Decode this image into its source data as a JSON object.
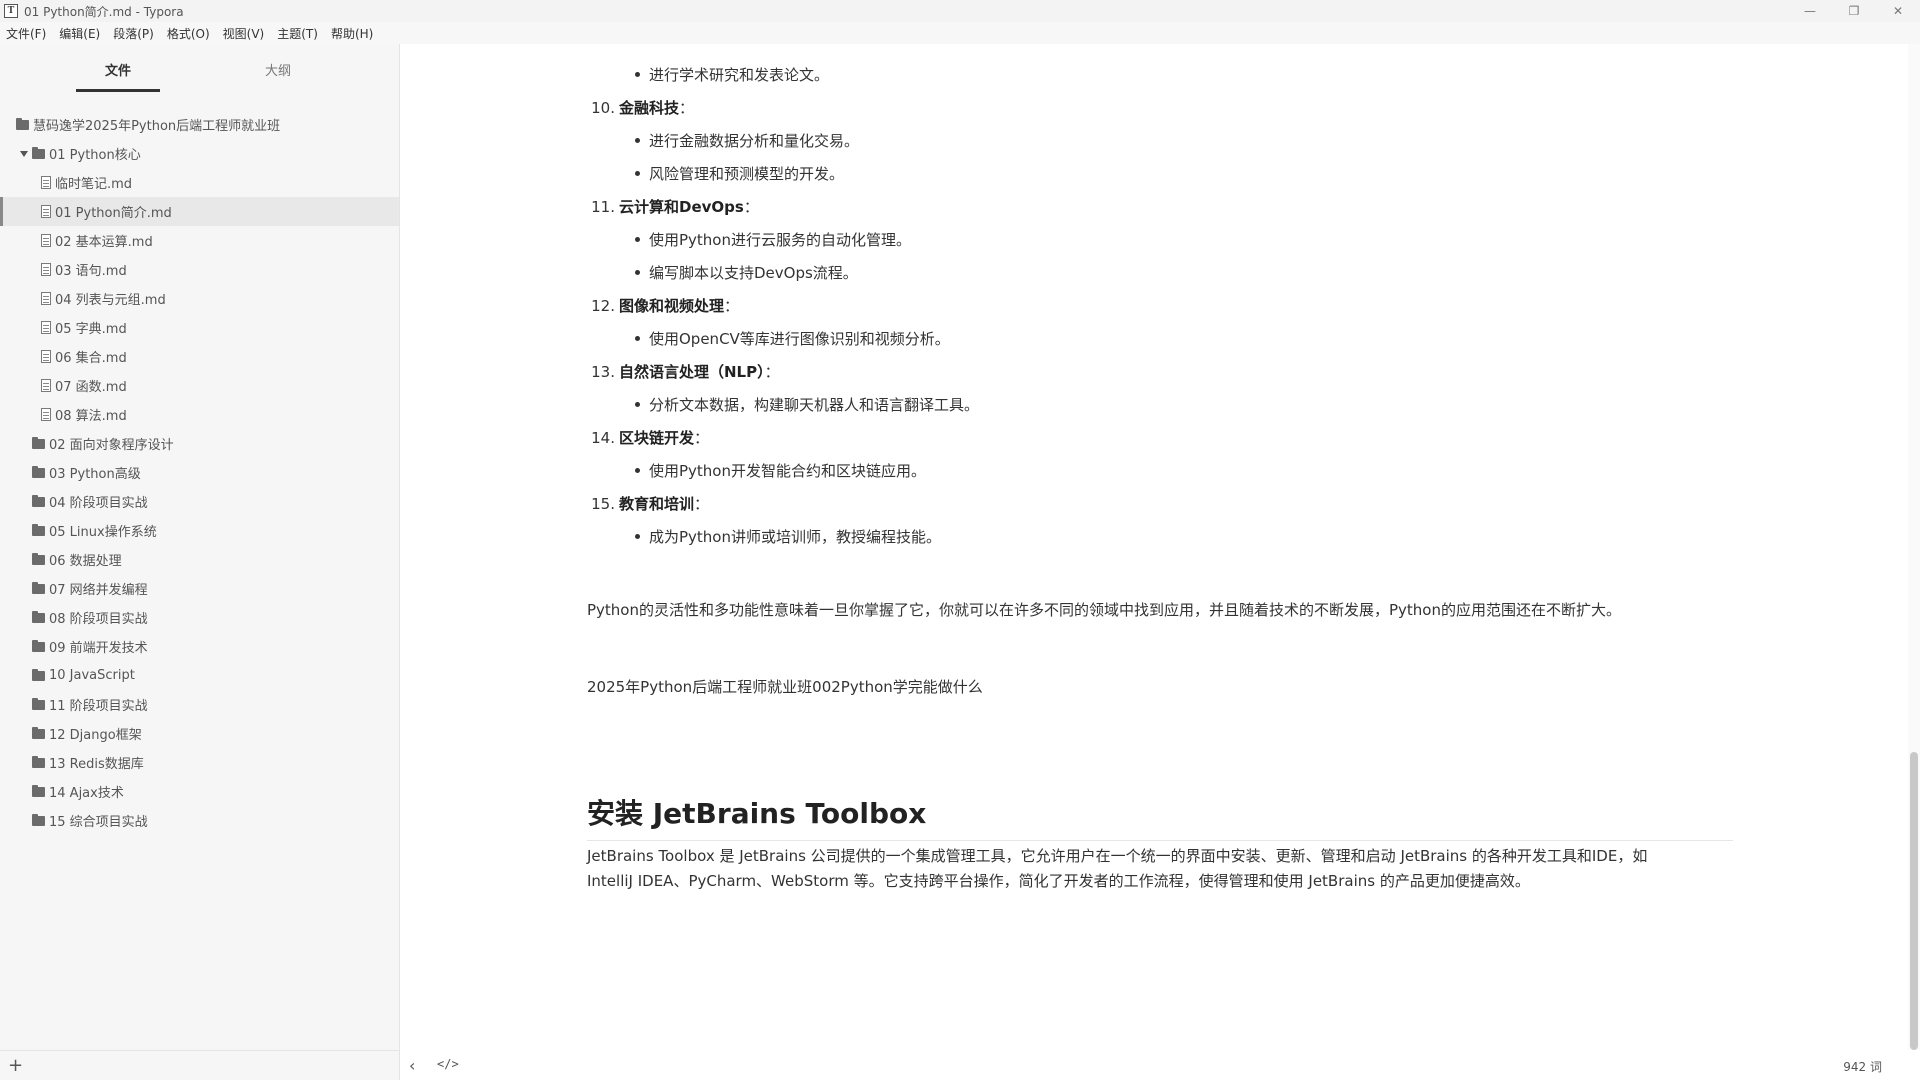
{
  "window": {
    "icon_letter": "T",
    "title": "01 Python简介.md - Typora",
    "minimize": "—",
    "maximize": "❐",
    "close": "✕"
  },
  "menu": [
    "文件(F)",
    "编辑(E)",
    "段落(P)",
    "格式(O)",
    "视图(V)",
    "主题(T)",
    "帮助(H)"
  ],
  "sidebar": {
    "tabs": [
      "文件",
      "大纲"
    ],
    "root": "慧码逸学2025年Python后端工程师就业班",
    "expanded_folder": "01 Python核心",
    "files": [
      "临时笔记.md",
      "01 Python简介.md",
      "02 基本运算.md",
      "03 语句.md",
      "04 列表与元组.md",
      "05 字典.md",
      "06 集合.md",
      "07 函数.md",
      "08 算法.md"
    ],
    "active_file_index": 1,
    "folders": [
      "02 面向对象程序设计",
      "03 Python高级",
      "04 阶段项目实战",
      "05 Linux操作系统",
      "06 数据处理",
      "07 网络并发编程",
      "08 阶段项目实战",
      "09 前端开发技术",
      "10 JavaScript",
      "11 阶段项目实战",
      "12 Django框架",
      "13 Redis数据库",
      "14 Ajax技术",
      "15 综合项目实战"
    ],
    "add_label": "+"
  },
  "editor": {
    "top_item": "进行学术研究和发表论文。",
    "sections": [
      {
        "num": "10.",
        "title": "金融科技",
        "suffix": "：",
        "items": [
          "进行金融数据分析和量化交易。",
          "风险管理和预测模型的开发。"
        ]
      },
      {
        "num": "11.",
        "title": "云计算和DevOps",
        "suffix": "：",
        "items": [
          "使用Python进行云服务的自动化管理。",
          "编写脚本以支持DevOps流程。"
        ]
      },
      {
        "num": "12.",
        "title": "图像和视频处理",
        "suffix": "：",
        "items": [
          "使用OpenCV等库进行图像识别和视频分析。"
        ]
      },
      {
        "num": "13.",
        "title": "自然语言处理（NLP）",
        "suffix": "：",
        "items": [
          "分析文本数据，构建聊天机器人和语言翻译工具。"
        ]
      },
      {
        "num": "14.",
        "title": "区块链开发",
        "suffix": "：",
        "items": [
          "使用Python开发智能合约和区块链应用。"
        ]
      },
      {
        "num": "15.",
        "title": "教育和培训",
        "suffix": "：",
        "items": [
          "成为Python讲师或培训师，教授编程技能。"
        ]
      }
    ],
    "para1": "Python的灵活性和多功能性意味着一旦你掌握了它，你就可以在许多不同的领域中找到应用，并且随着技术的不断发展，Python的应用范围还在不断扩大。",
    "para2": "2025年Python后端工程师就业班002Python学完能做什么",
    "heading": "安装 JetBrains Toolbox",
    "para3_line1": "JetBrains Toolbox 是 JetBrains 公司提供的一个集成管理工具，它允许用户在一个统一的界面中安装、更新、管理和启动 JetBrains 的各种开发工具和IDE，如",
    "para3_line2": "IntelliJ IDEA、PyCharm、WebStorm 等。它支持跨平台操作，简化了开发者的工作流程，使得管理和使用 JetBrains 的产品更加便捷高效。"
  },
  "footer": {
    "back": "‹",
    "source": "</>",
    "word_count": "942 词"
  }
}
